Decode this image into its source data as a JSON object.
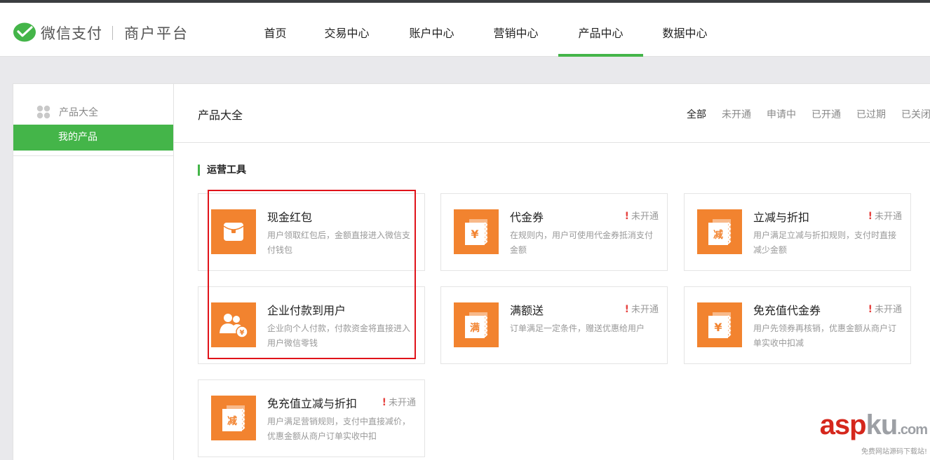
{
  "header": {
    "brand": "微信支付",
    "subtitle": "商户平台",
    "nav": [
      {
        "label": "首页",
        "active": false
      },
      {
        "label": "交易中心",
        "active": false
      },
      {
        "label": "账户中心",
        "active": false
      },
      {
        "label": "营销中心",
        "active": false
      },
      {
        "label": "产品中心",
        "active": true
      },
      {
        "label": "数据中心",
        "active": false
      }
    ]
  },
  "sidebar": {
    "heading": "产品大全",
    "heading_icon": "grid-dots-icon",
    "items": [
      {
        "label": "我的产品",
        "active": true
      }
    ]
  },
  "main": {
    "title": "产品大全",
    "filters": [
      {
        "label": "全部",
        "active": true
      },
      {
        "label": "未开通",
        "active": false
      },
      {
        "label": "申请中",
        "active": false
      },
      {
        "label": "已开通",
        "active": false
      },
      {
        "label": "已过期",
        "active": false
      },
      {
        "label": "已关闭",
        "active": false
      }
    ],
    "section": "运营工具",
    "products": [
      {
        "name": "现金红包",
        "desc": "用户领取红包后，金额直接进入微信支付钱包",
        "status": "",
        "icon": "red-envelope-icon"
      },
      {
        "name": "代金券",
        "desc": "在规则内，用户可使用代金券抵消支付金额",
        "status": "未开通",
        "icon": "yuan-voucher-icon"
      },
      {
        "name": "立减与折扣",
        "desc": "用户满足立减与折扣规则，支付时直接减少金额",
        "status": "未开通",
        "icon": "discount-voucher-icon"
      },
      {
        "name": "企业付款到用户",
        "desc": "企业向个人付款，付款资金将直接进入用户微信零钱",
        "status": "",
        "icon": "enterprise-payment-icon"
      },
      {
        "name": "满额送",
        "desc": "订单满足一定条件，赠送优惠给用户",
        "status": "未开通",
        "icon": "full-amount-gift-icon"
      },
      {
        "name": "免充值代金券",
        "desc": "用户先领券再核销，优惠金额从商户订单实收中扣减",
        "status": "未开通",
        "icon": "yuan-voucher-icon"
      },
      {
        "name": "免充值立减与折扣",
        "desc": "用户满足营销规则，支付中直接减价，优惠金额从商户订单实收中扣",
        "status": "未开通",
        "icon": "discount-voucher-icon"
      }
    ]
  },
  "icon_glyphs": {
    "yuan": "¥",
    "jian": "减",
    "man": "满"
  },
  "watermark": {
    "main": "asp",
    "ku": "ku",
    "com": ".com",
    "sub": "免费网站源码下载站!"
  },
  "colors": {
    "accent": "#44b549",
    "icon_bg": "#f2832f",
    "highlight": "#e0131a",
    "alert": "#e64340"
  }
}
